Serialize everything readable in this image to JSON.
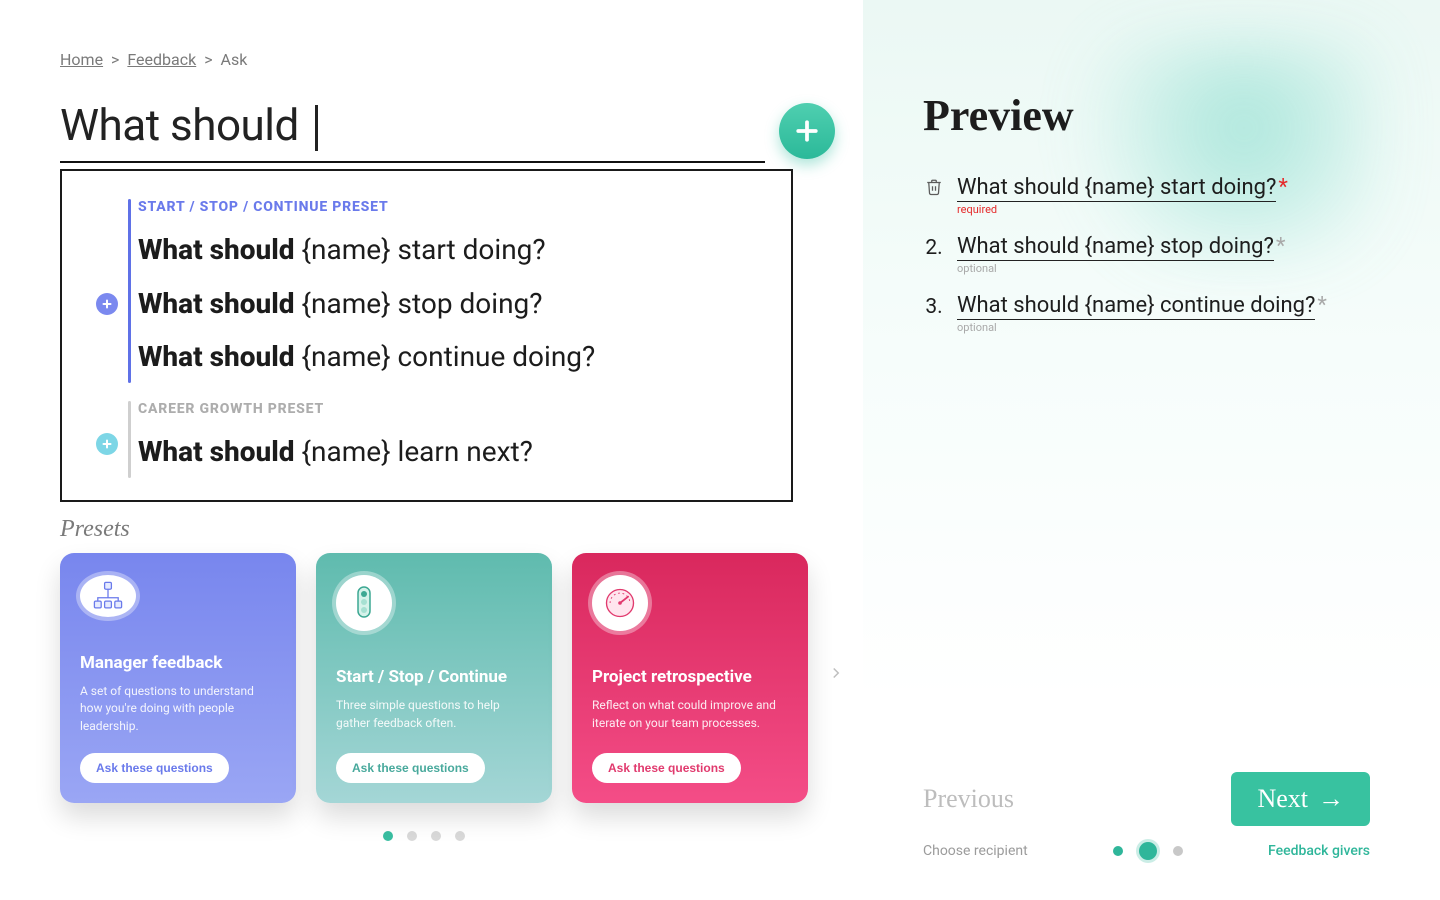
{
  "breadcrumb": {
    "home": "Home",
    "feedback": "Feedback",
    "current": "Ask"
  },
  "search": {
    "value": "What should "
  },
  "dropdown": {
    "group1": {
      "label": "START / STOP / CONTINUE PRESET",
      "rows": [
        {
          "bold": "What should ",
          "rest": "{name} start doing?"
        },
        {
          "bold": "What should ",
          "rest": "{name} stop doing?"
        },
        {
          "bold": "What should ",
          "rest": "{name} continue doing?"
        }
      ]
    },
    "group2": {
      "label": "CAREER GROWTH PRESET",
      "rows": [
        {
          "bold": "What should ",
          "rest": "{name} learn next?"
        }
      ]
    }
  },
  "presets_heading": "Presets",
  "cards": [
    {
      "title": "Manager feedback",
      "desc": "A set of questions to understand how you're doing with people leadership.",
      "btn": "Ask these questions"
    },
    {
      "title": "Start / Stop / Continue",
      "desc": "Three simple questions to help gather feedback often.",
      "btn": "Ask these questions"
    },
    {
      "title": "Project retrospective",
      "desc": "Reflect on what could improve and iterate on your team processes.",
      "btn": "Ask these questions"
    }
  ],
  "preview": {
    "title": "Preview",
    "items": [
      {
        "text": "What should {name} start doing?",
        "note": "required",
        "required": true
      },
      {
        "text": "What should {name} stop doing?",
        "note": "optional",
        "required": false
      },
      {
        "text": "What should {name} continue doing?",
        "note": "optional",
        "required": false
      }
    ]
  },
  "footer": {
    "previous": "Previous",
    "next": "Next",
    "choose": "Choose recipient",
    "givers": "Feedback givers"
  }
}
